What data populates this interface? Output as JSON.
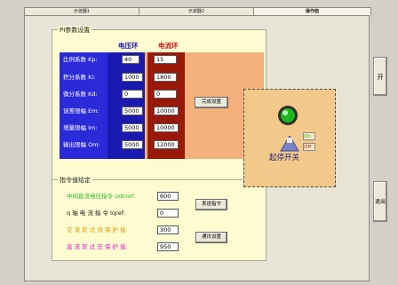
{
  "tabs": [
    {
      "label": "示波器1"
    },
    {
      "label": "示波器2"
    },
    {
      "label": "操作面"
    }
  ],
  "pi_group": {
    "title": "PI参数设置",
    "col_voltage": "电压环",
    "col_current": "电流环",
    "rows": [
      {
        "label": "比例系数 Kp:",
        "voltage": "40",
        "current": "15"
      },
      {
        "label": "积分系数 Ki:",
        "voltage": "1000",
        "current": "1800"
      },
      {
        "label": "微分系数 Kd:",
        "voltage": "0",
        "current": "0"
      },
      {
        "label": "误差限幅 Em:",
        "voltage": "5000",
        "current": "10000"
      },
      {
        "label": "增量限幅 Im:",
        "voltage": "5000",
        "current": "10000"
      },
      {
        "label": "输出限幅 Om:",
        "voltage": "5000",
        "current": "12000"
      }
    ],
    "send_label": "完成设置"
  },
  "cmd_group": {
    "title": "指令值给定",
    "rows": [
      {
        "label": "中间直流电压指令 Udcref:",
        "value": "600",
        "color": "#2bb82b"
      },
      {
        "label": "q 轴 电 流 指 令 Iqref:",
        "value": "0",
        "color": "#1a1a1a"
      },
      {
        "label": "交 流 软 过 流 保 护 值:",
        "value": "300",
        "color": "#d49a00"
      },
      {
        "label": "直 流 软 过 压 保 护 值:",
        "value": "950",
        "color": "#d11fd1"
      }
    ],
    "send_cmd_label": "发送指令",
    "send_protect_label": "通讯设置"
  },
  "switch_panel": {
    "on_label": "On",
    "off_label": "Off",
    "caption": "起停开关",
    "indicator_color": "#1fb81f"
  },
  "side_buttons": {
    "start": "开",
    "exit": "退出"
  }
}
